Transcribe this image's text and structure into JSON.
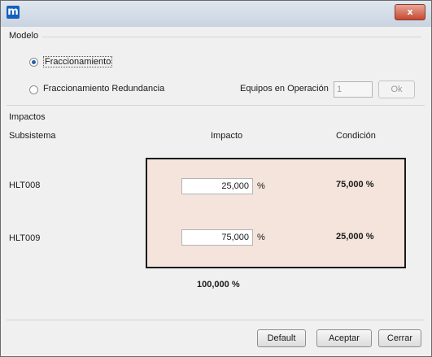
{
  "window": {
    "app_icon_glyph": "m",
    "close_glyph": "x"
  },
  "modelo": {
    "legend": "Modelo",
    "options": [
      {
        "label": "Fraccionamiento",
        "selected": true
      },
      {
        "label": "Fraccionamiento Redundancia",
        "selected": false
      }
    ],
    "equipos_label": "Equipos en Operación",
    "equipos_value": "1",
    "ok_label": "Ok"
  },
  "impactos": {
    "legend": "Impactos",
    "headers": {
      "subsistema": "Subsistema",
      "impacto": "Impacto",
      "condicion": "Condición"
    },
    "rows": [
      {
        "subsistema": "HLT008",
        "impacto": "25,000",
        "unit": "%",
        "condicion": "75,000 %"
      },
      {
        "subsistema": "HLT009",
        "impacto": "75,000",
        "unit": "%",
        "condicion": "25,000 %"
      }
    ],
    "total": "100,000 %",
    "box_color": "#f4e4dc"
  },
  "footer": {
    "default_label": "Default",
    "aceptar_label": "Aceptar",
    "cerrar_label": "Cerrar"
  },
  "icons": {
    "app": "app-logo-icon",
    "close": "close-icon"
  }
}
